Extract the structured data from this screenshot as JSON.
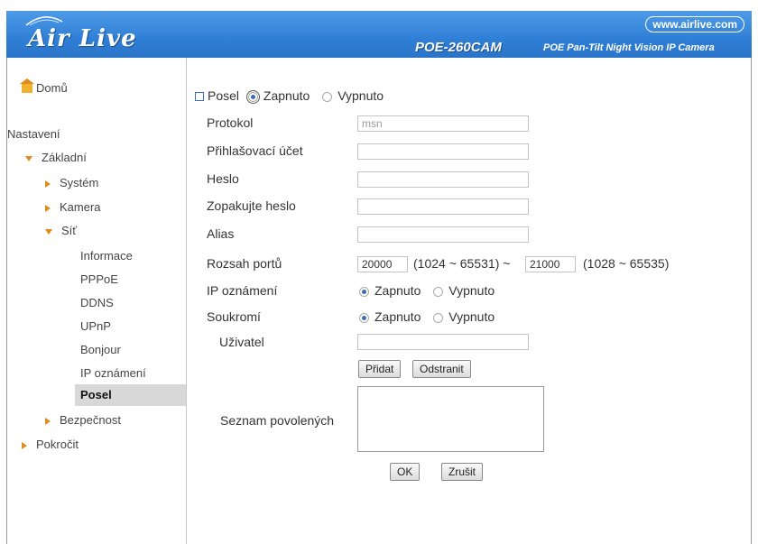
{
  "header": {
    "logo": "Air Live",
    "url": "www.airlive.com",
    "model": "POE-260CAM",
    "subtitle": "POE Pan-Tilt Night Vision IP Camera"
  },
  "sidebar": {
    "home": "Domů",
    "section": "Nastavení",
    "basic": "Základní",
    "system": "Systém",
    "camera": "Kamera",
    "network": "Síť",
    "network_items": [
      "Informace",
      "PPPoE",
      "DDNS",
      "UPnP",
      "Bonjour",
      "IP oznámení",
      "Posel"
    ],
    "security": "Bezpečnost",
    "advanced": "Pokročit"
  },
  "form": {
    "enable_label": "Posel",
    "on": "Zapnuto",
    "off": "Vypnuto",
    "protocol_label": "Protokol",
    "protocol_value": "msn",
    "login_label": "Přihlašovací účet",
    "password_label": "Heslo",
    "repeat_password_label": "Zopakujte heslo",
    "alias_label": "Alias",
    "port_range_label": "Rozsah portů",
    "port_from": "20000",
    "port_from_range": "(1024 ~ 65531) ~",
    "port_to": "21000",
    "port_to_range": "(1028 ~ 65535)",
    "ip_notify_label": "IP oznámení",
    "privacy_label": "Soukromí",
    "user_label": "Uživatel",
    "add_button": "Přidat",
    "remove_button": "Odstranit",
    "allowed_list_label": "Seznam povolených",
    "ok_button": "OK",
    "cancel_button": "Zrušit"
  },
  "colors": {
    "header_blue": "#2f7fd6",
    "accent_orange": "#e08a1a"
  }
}
